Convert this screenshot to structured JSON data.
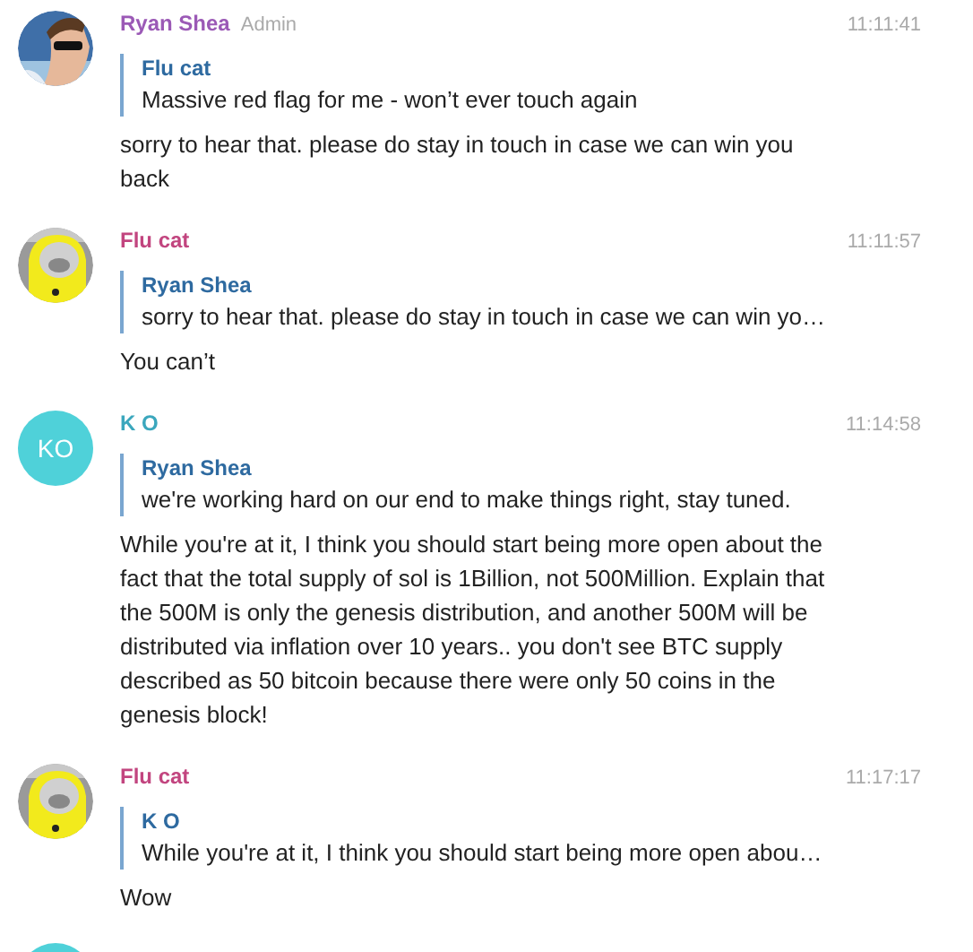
{
  "messages": [
    {
      "author": "Ryan Shea",
      "color": "#9b59b6",
      "role": "Admin",
      "time": "11:11:41",
      "quote": {
        "author": "Flu cat",
        "text": "Massive red flag for me - won’t ever touch again"
      },
      "text": "sorry to hear that. please do stay in touch in case we can win you back"
    },
    {
      "avatar": {
        "kind": "cat"
      },
      "author": "Flu cat",
      "color": "#c2457f",
      "time": "11:11:57",
      "quote": {
        "author": "Ryan Shea",
        "text": "sorry to hear that. please do stay in touch in case we can win yo…"
      },
      "text": "You can’t"
    },
    {
      "avatar": {
        "kind": "initials",
        "initials": "KO",
        "color": "#4fd1d9"
      },
      "author": "K O",
      "color": "#3ba7bd",
      "time": "11:14:58",
      "quote": {
        "author": "Ryan Shea",
        "text": "we're working hard on our end to make things right, stay tuned."
      },
      "text": "While you're at it, I think you should start being more open about the fact that the total supply of sol is 1Billion, not 500Million. Explain that the 500M is only the genesis distribution, and another 500M will be distributed via inflation over 10 years.. you don't see BTC supply described as 50 bitcoin because there were only 50 coins in the genesis block!"
    },
    {
      "avatar": {
        "kind": "cat"
      },
      "author": "Flu cat",
      "color": "#c2457f",
      "time": "11:17:17",
      "quote": {
        "author": "K O",
        "text": "While you're at it, I think you should start being more open abou…"
      },
      "text": "Wow"
    },
    {
      "avatar": {
        "kind": "initials",
        "color": "#4fd1d9"
      }
    }
  ]
}
